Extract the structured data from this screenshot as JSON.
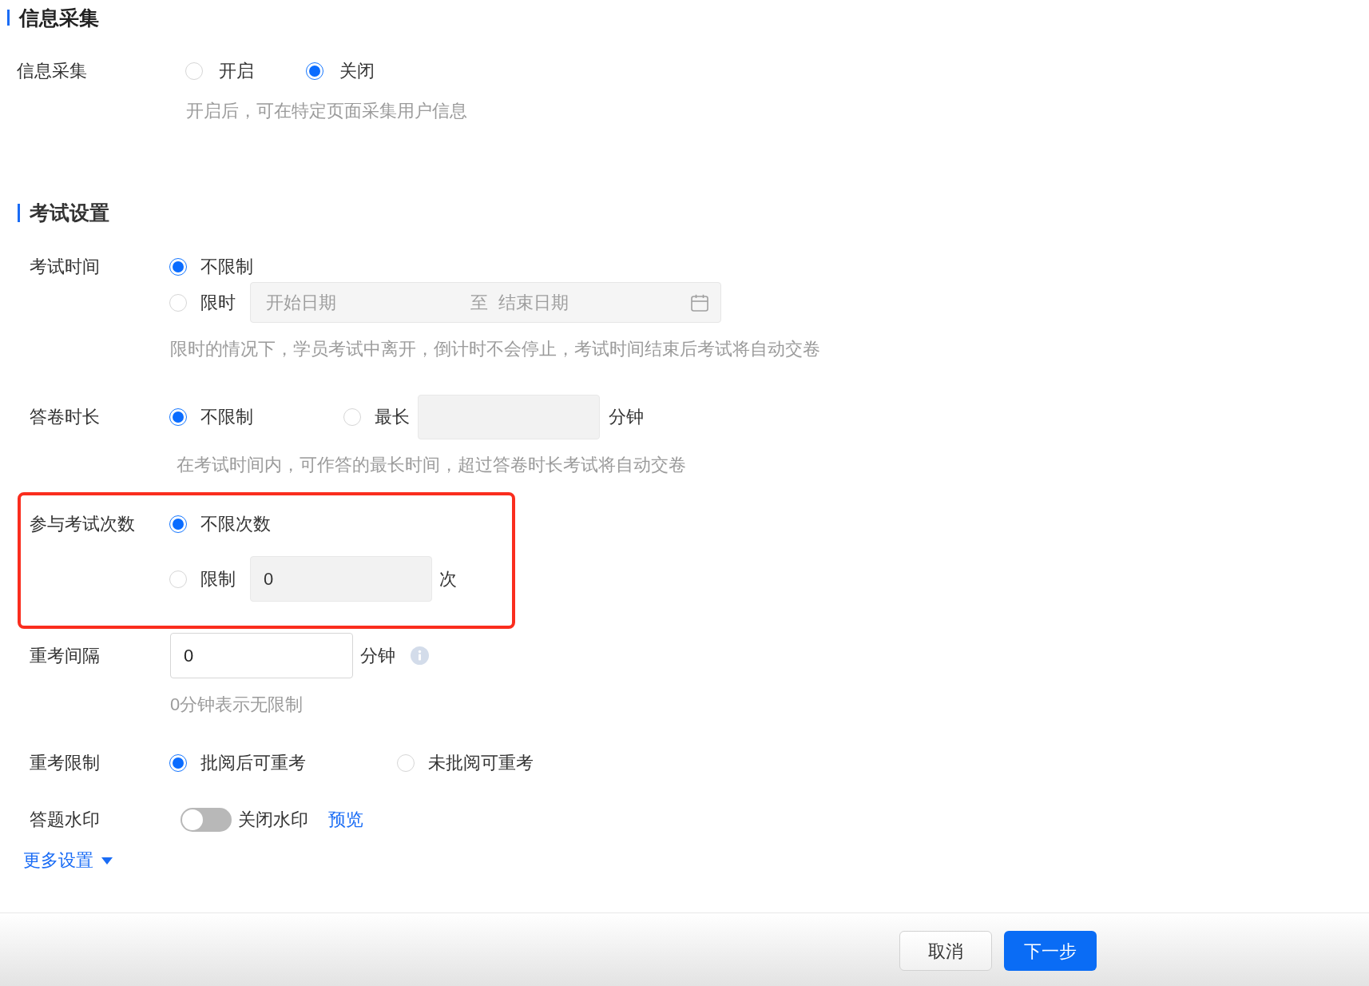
{
  "info_section": {
    "title": "信息采集",
    "collection": {
      "label": "信息采集",
      "options": [
        {
          "label": "开启",
          "selected": false
        },
        {
          "label": "关闭",
          "selected": true
        }
      ],
      "hint": "开启后，可在特定页面采集用户信息"
    }
  },
  "exam_section": {
    "title": "考试设置",
    "exam_time": {
      "label": "考试时间",
      "options": [
        {
          "label": "不限制",
          "selected": true
        },
        {
          "label": "限时",
          "selected": false
        }
      ],
      "date_range": {
        "start_placeholder": "开始日期",
        "separator": "至",
        "end_placeholder": "结束日期",
        "disabled": true
      },
      "hint": "限时的情况下，学员考试中离开，倒计时不会停止，考试时间结束后考试将自动交卷"
    },
    "answer_duration": {
      "label": "答卷时长",
      "options": [
        {
          "label": "不限制",
          "selected": true
        },
        {
          "label": "最长",
          "selected": false
        }
      ],
      "field": {
        "disabled": true
      },
      "unit": "分钟",
      "hint": "在考试时间内，可作答的最长时间，超过答卷时长考试将自动交卷"
    },
    "attempts": {
      "label": "参与考试次数",
      "highlighted": true,
      "options": [
        {
          "label": "不限次数",
          "selected": true
        },
        {
          "label": "限制",
          "selected": false
        }
      ],
      "field": {
        "value": "0",
        "disabled": true
      },
      "unit": "次"
    },
    "retake_interval": {
      "label": "重考间隔",
      "field": {
        "value": "0",
        "disabled": false
      },
      "unit": "分钟",
      "hint": "0分钟表示无限制"
    },
    "retake_limit": {
      "label": "重考限制",
      "options": [
        {
          "label": "批阅后可重考",
          "selected": true
        },
        {
          "label": "未批阅可重考",
          "selected": false
        }
      ]
    },
    "watermark": {
      "label": "答题水印",
      "on": false,
      "status": "关闭水印",
      "link": "预览"
    },
    "more_settings": {
      "label": "更多设置",
      "expanded": false
    }
  },
  "footer": {
    "buttons": [
      {
        "label": "取消",
        "kind": "secondary"
      },
      {
        "label": "下一步",
        "kind": "primary"
      }
    ]
  }
}
